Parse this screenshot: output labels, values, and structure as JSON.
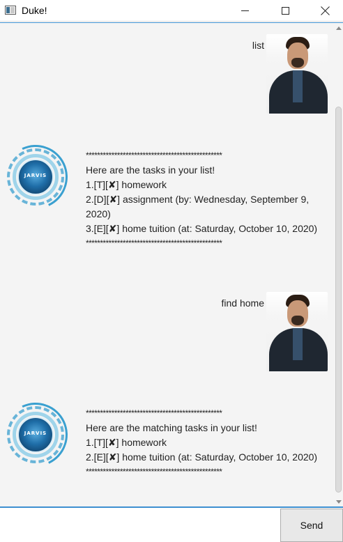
{
  "window": {
    "title": "Duke!",
    "controls": {
      "minimize": "minimize-icon",
      "maximize": "maximize-icon",
      "close": "close-icon"
    }
  },
  "chat": {
    "messages": [
      {
        "sender": "user",
        "text": "list"
      },
      {
        "sender": "bot",
        "avatar_label": "JARVIS",
        "lines": [
          "************************************************",
          "Here are the tasks in your list!",
          "1.[T][✘] homework",
          "2.[D][✘] assignment (by: Wednesday, September 9, 2020)",
          "3.[E][✘] home tuition (at: Saturday, October 10, 2020)",
          "************************************************"
        ]
      },
      {
        "sender": "user",
        "text": "find home"
      },
      {
        "sender": "bot",
        "avatar_label": "JARVIS",
        "lines": [
          "************************************************",
          "Here are the matching tasks in your list!",
          "1.[T][✘] homework",
          "2.[E][✘] home tuition (at: Saturday, October 10, 2020)",
          "************************************************"
        ]
      }
    ]
  },
  "input": {
    "value": "",
    "placeholder": ""
  },
  "send_button": {
    "label": "Send"
  },
  "colors": {
    "accent": "#3d8fd0",
    "chat_bg": "#f4f4f4"
  }
}
